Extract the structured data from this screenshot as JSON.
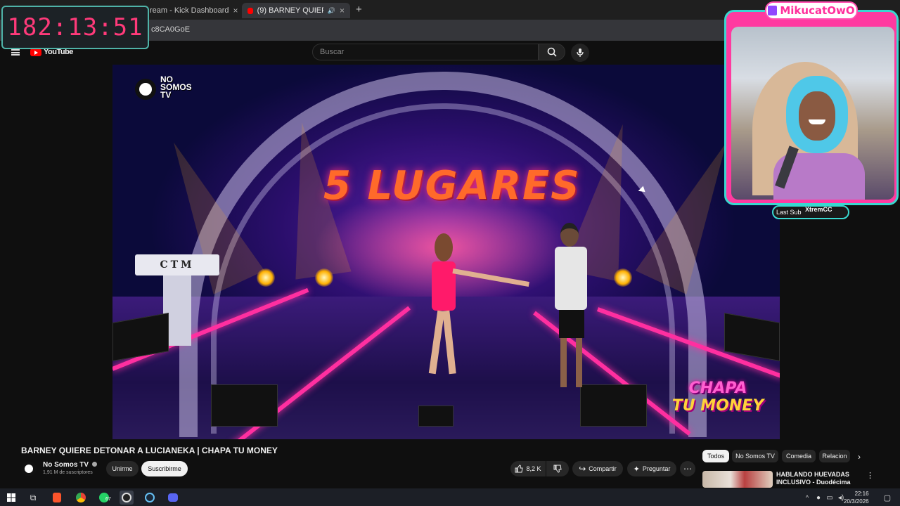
{
  "browser": {
    "tabs": [
      {
        "label": "ream - Kick Dashboard",
        "active": false
      },
      {
        "label": "(9) BARNEY QUIERE DETON",
        "active": true
      }
    ],
    "url": "c8CA0GoE"
  },
  "youtube": {
    "logo": "YouTube",
    "search_placeholder": "Buscar"
  },
  "video": {
    "overlay_text": "5 LUGARES",
    "watermark": "NO SOMOS TV",
    "podium_text": "CTM",
    "show_logo_line1": "CHAPA",
    "show_logo_line2": "TU MONEY"
  },
  "details": {
    "title": "BARNEY QUIERE DETONAR A LUCIANEKA | CHAPA TU MONEY",
    "channel_name": "No Somos TV",
    "subscribers": "1,91 M de suscriptores",
    "join_label": "Unirme",
    "subscribe_label": "Suscribirme",
    "likes": "8,2 K",
    "share_label": "Compartir",
    "ask_label": "Preguntar"
  },
  "related": {
    "chips": [
      "Todos",
      "No Somos TV",
      "Comedia",
      "Relacion"
    ],
    "first_title": "HABLANDO HUEVADAS INCLUSIVO - Duodécima ..."
  },
  "overlays": {
    "timer": "182:13:51",
    "streamer_name": "MikucatOwO",
    "last_sub_label": "Last Sub",
    "last_sub_name": "XtremCC"
  },
  "taskbar": {
    "whatsapp_badge": "67",
    "time": "22:16",
    "date": "20/3/2026"
  },
  "colors": {
    "accent_pink": "#ff2f9c",
    "accent_cyan": "#39d8d0",
    "youtube_red": "#ff0000"
  }
}
